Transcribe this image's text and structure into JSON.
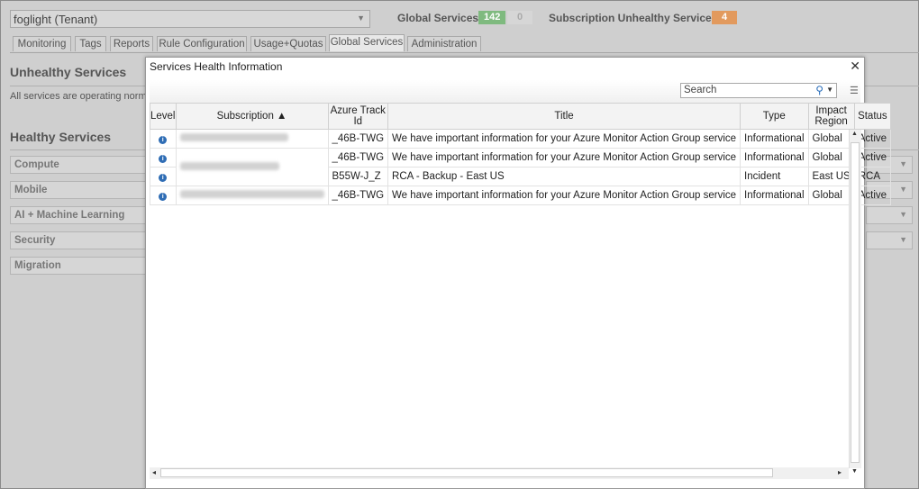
{
  "tenant": {
    "value": "foglight (Tenant)"
  },
  "global_services": {
    "label": "Global Services:",
    "healthy": "142",
    "other": "0"
  },
  "subscription_unhealthy": {
    "label": "Subscription Unhealthy Services:",
    "count": "4"
  },
  "tabs": [
    "Monitoring",
    "Tags",
    "Reports",
    "Rule Configuration",
    "Usage+Quotas",
    "Global Services",
    "Administration"
  ],
  "active_tab": "Global Services",
  "page": {
    "unhealthy_title": "Unhealthy Services",
    "unhealthy_note": "All services are operating norma",
    "healthy_title": "Healthy Services",
    "categories": [
      "Compute",
      "Mobile",
      "AI + Machine Learning",
      "Security",
      "Migration"
    ]
  },
  "dialog": {
    "title": "Services Health Information",
    "close": "✕",
    "search_placeholder": "Search",
    "columns": {
      "level": "Level",
      "subscription": "Subscription ▲",
      "track": "Azure Track Id",
      "title": "Title",
      "type": "Type",
      "region": "Impact Region",
      "status": "Status"
    },
    "rows": [
      {
        "track": "_46B-TWG",
        "title": "We have important information for your Azure Monitor Action Group service",
        "type": "Informational",
        "region": "Global",
        "status": "Active"
      },
      {
        "track": "_46B-TWG",
        "title": "We have important information for your Azure Monitor Action Group service",
        "type": "Informational",
        "region": "Global",
        "status": "Active"
      },
      {
        "track": "B55W-J_Z",
        "title": "RCA - Backup - East US",
        "type": "Incident",
        "region": "East US",
        "status": "RCA"
      },
      {
        "track": "_46B-TWG",
        "title": "We have important information for your Azure Monitor Action Group service",
        "type": "Informational",
        "region": "Global",
        "status": "Active"
      }
    ]
  },
  "colors": {
    "healthy_badge": "#7fba7f",
    "unhealthy_badge": "#e29a5e",
    "info_icon": "#2f6db5"
  }
}
